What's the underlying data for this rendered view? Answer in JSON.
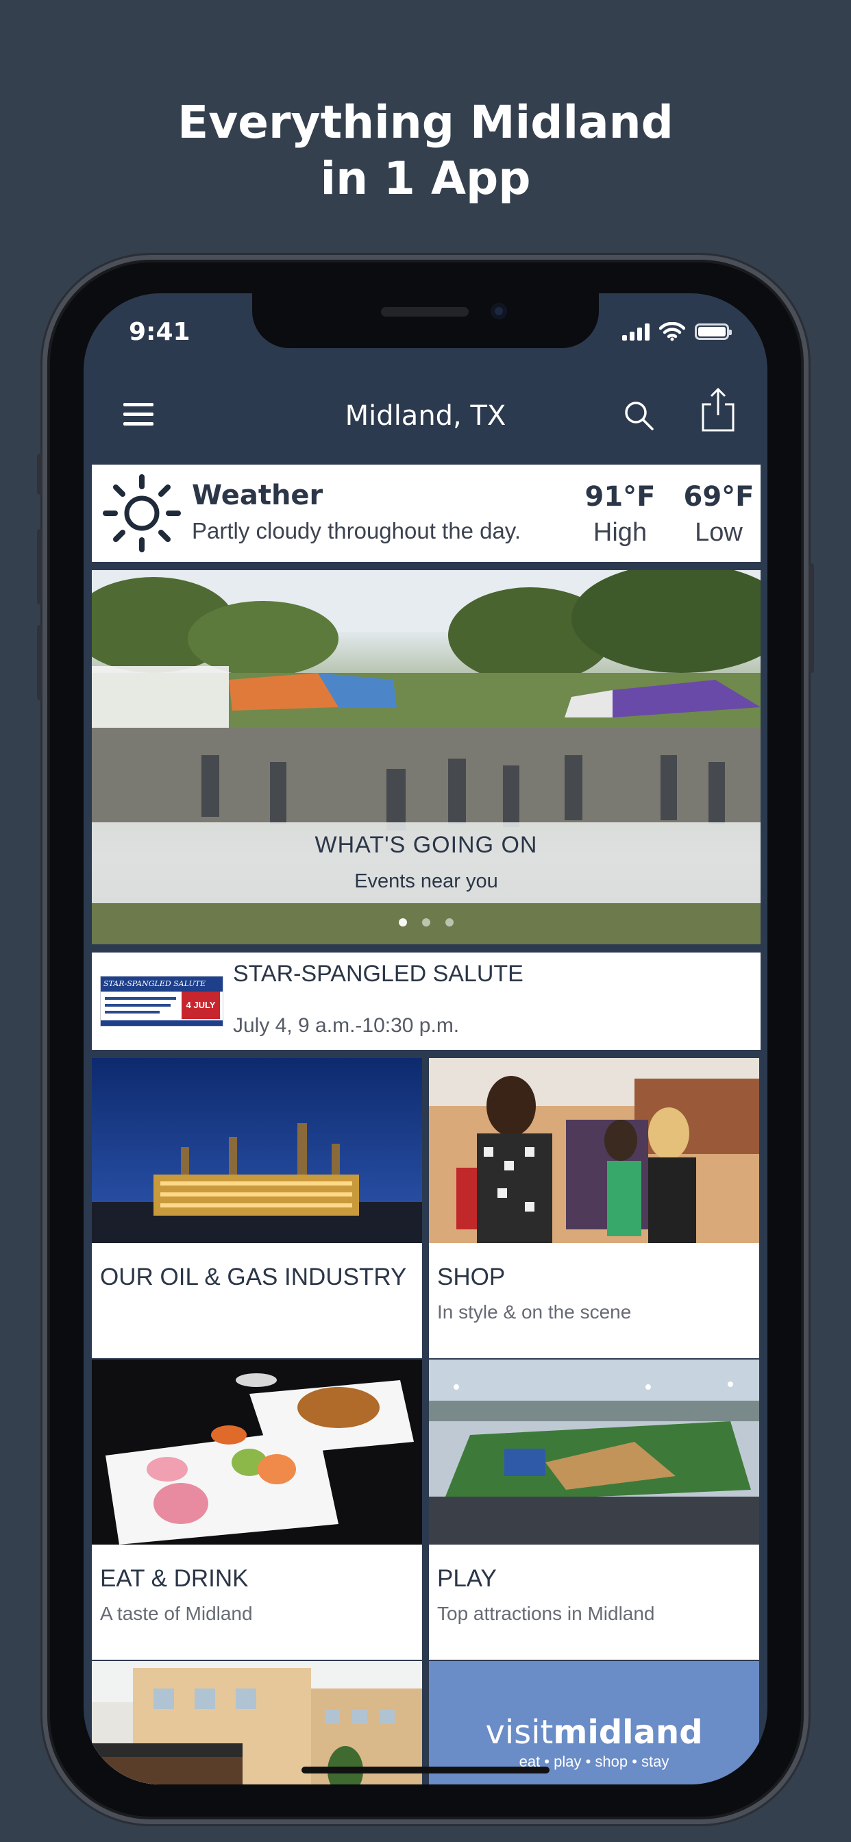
{
  "marketing": {
    "headline_line1": "Everything Midland",
    "headline_line2": "in 1 App"
  },
  "status_bar": {
    "time": "9:41"
  },
  "nav": {
    "title": "Midland, TX"
  },
  "weather": {
    "title": "Weather",
    "description": "Partly cloudy throughout the day.",
    "high_temp": "91°F",
    "high_label": "High",
    "low_temp": "69°F",
    "low_label": "Low"
  },
  "hero": {
    "title": "WHAT'S GOING ON",
    "subtitle": "Events near you",
    "page_count": 3,
    "active_page": 1
  },
  "event": {
    "title": "STAR-SPANGLED SALUTE",
    "date": "July 4, 9 a.m.-10:30 p.m.",
    "thumb_text": "STAR-SPANGLED SALUTE",
    "thumb_badge": "4 JULY"
  },
  "tiles": [
    {
      "title": "OUR OIL & GAS INDUSTRY",
      "subtitle": ""
    },
    {
      "title": "SHOP",
      "subtitle": "In style & on the scene"
    },
    {
      "title": "EAT & DRINK",
      "subtitle": "A taste of Midland"
    },
    {
      "title": "PLAY",
      "subtitle": "Top attractions in Midland"
    }
  ],
  "visit_logo": {
    "part1": "visit",
    "part2": "midland",
    "tagline": "eat • play • shop • stay"
  },
  "colors": {
    "background": "#35404f",
    "app_bar": "#2c3a4f",
    "text_dark": "#2b3648",
    "logo_tile": "#6a8cc7"
  }
}
